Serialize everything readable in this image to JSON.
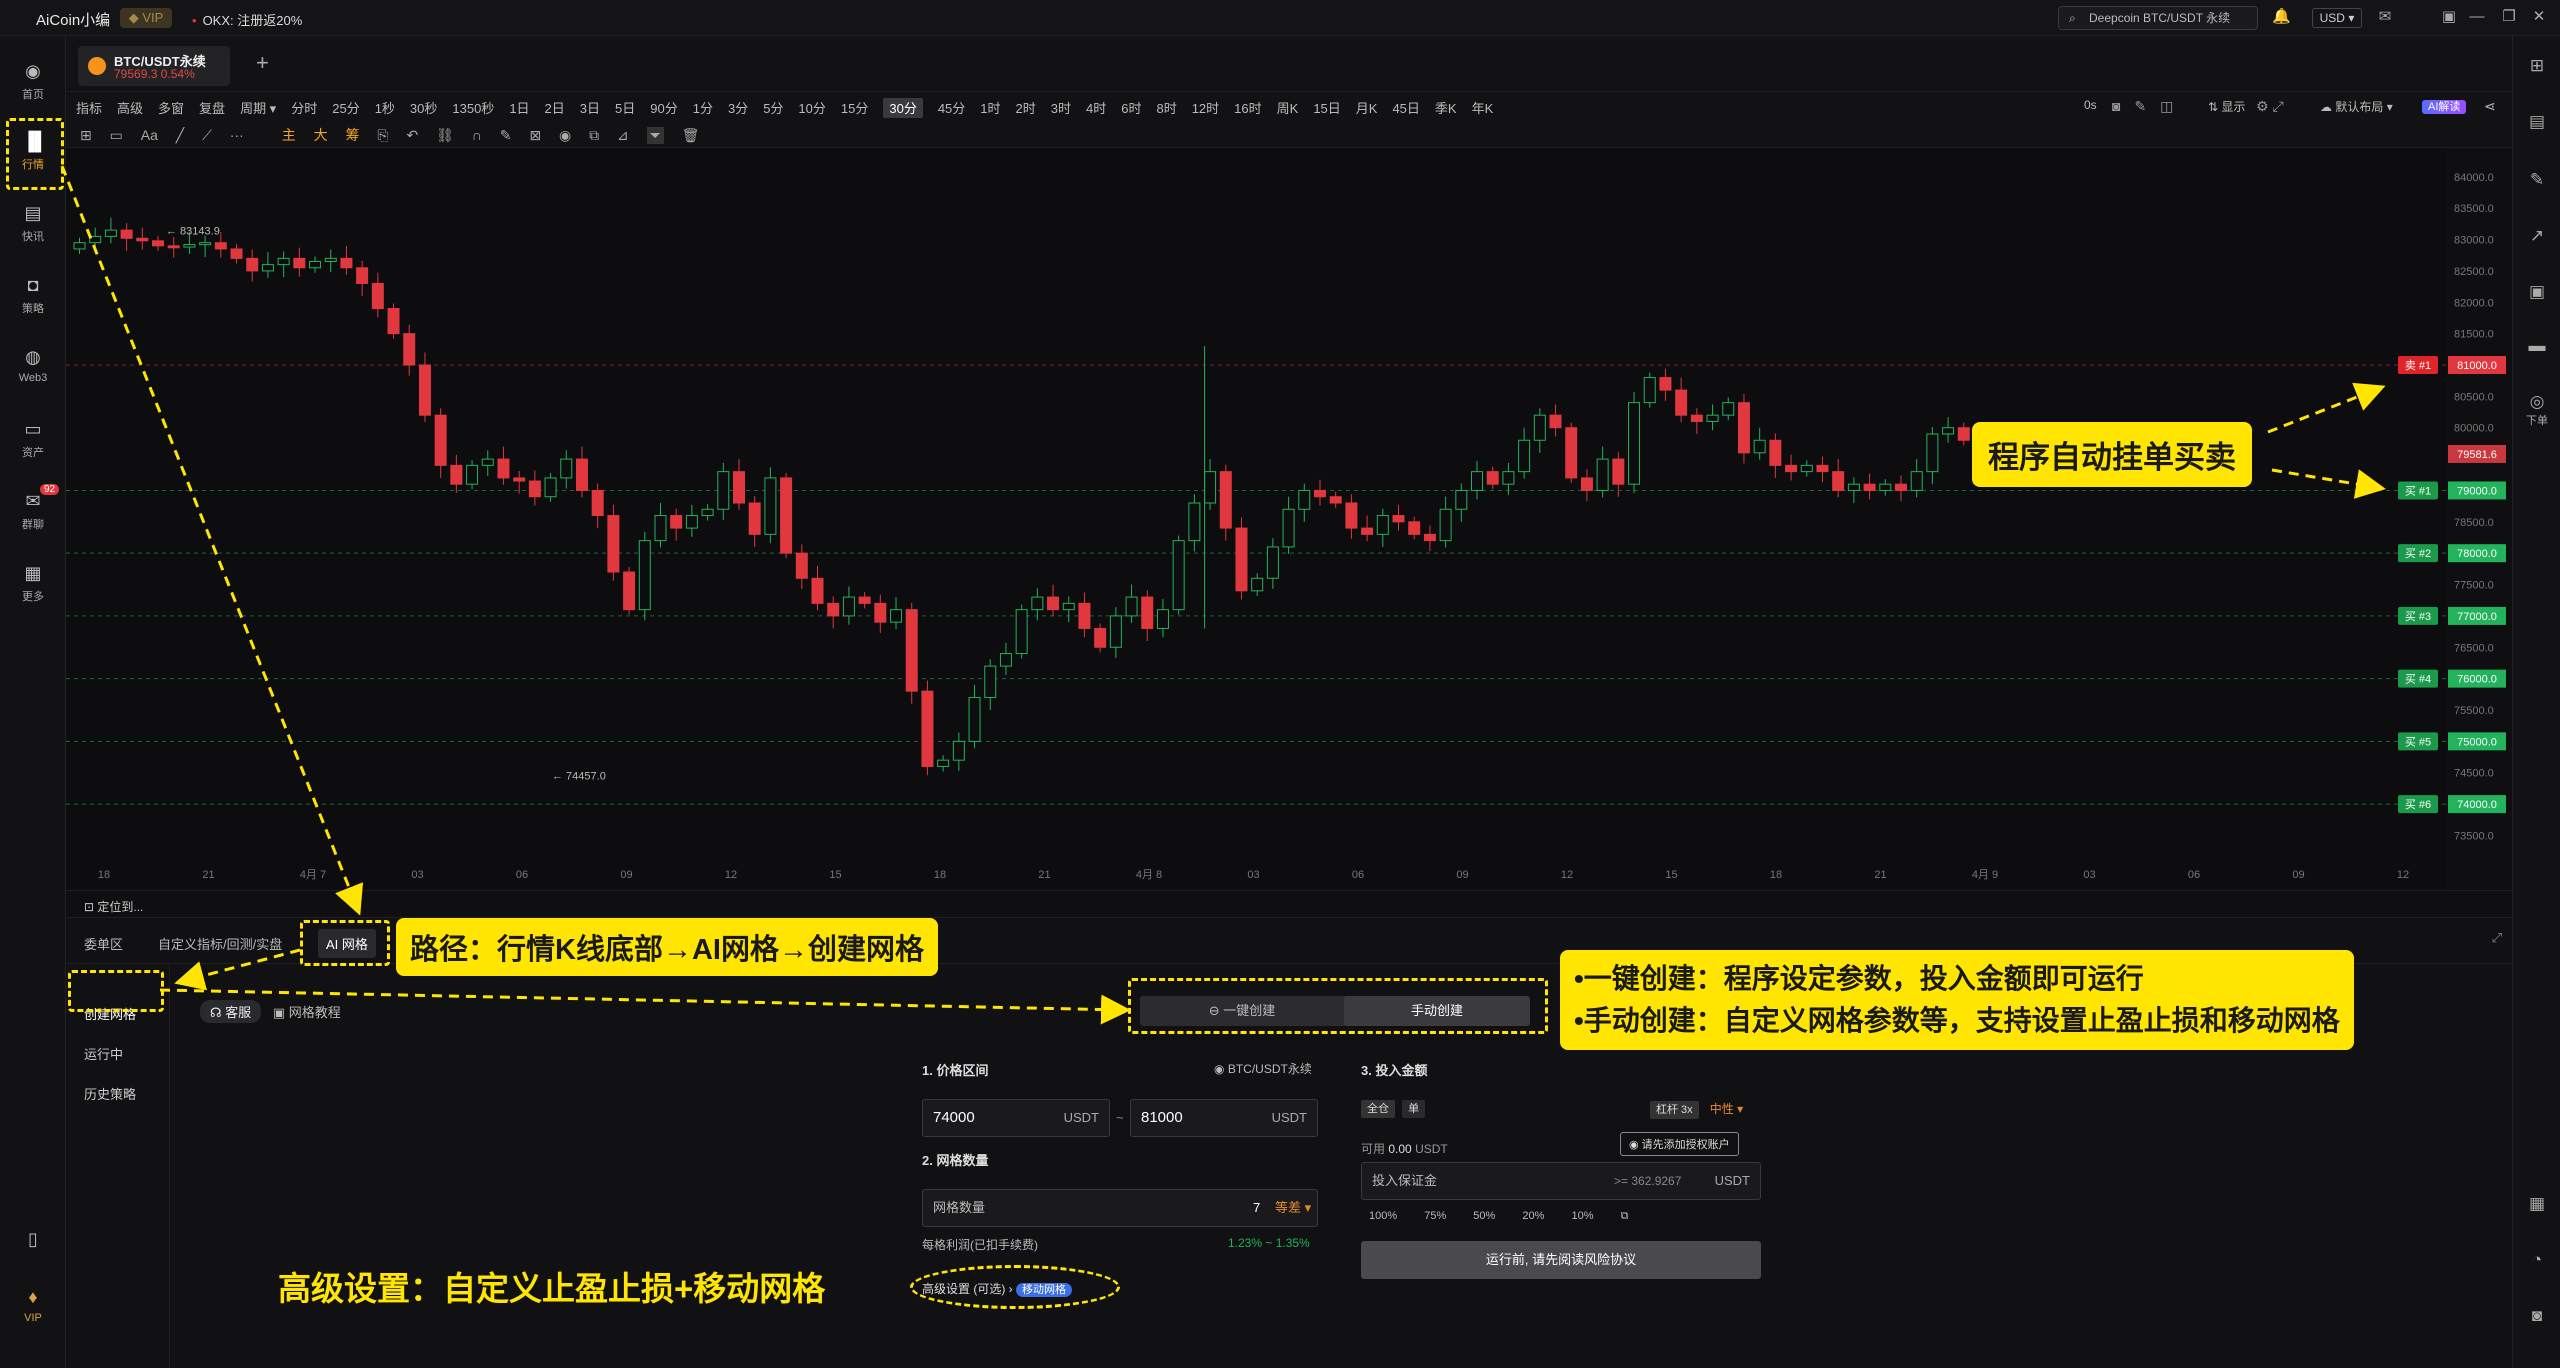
{
  "topbar": {
    "brand": "AiCoin小编",
    "vip": "VIP",
    "promo": "OKX: 注册返20%",
    "search": "Deepcoin BTC/USDT 永续",
    "currency": "USD"
  },
  "leftnav": [
    {
      "label": "首页",
      "icon": "home-icon"
    },
    {
      "label": "行情",
      "icon": "chart-bar-icon"
    },
    {
      "label": "快讯",
      "icon": "news-icon"
    },
    {
      "label": "策略",
      "icon": "robot-icon"
    },
    {
      "label": "Web3",
      "icon": "web3-icon"
    },
    {
      "label": "资产",
      "icon": "wallet-icon"
    },
    {
      "label": "群聊",
      "icon": "chat-icon",
      "badge": "92"
    },
    {
      "label": "更多",
      "icon": "grid-icon"
    },
    {
      "label": "VIP",
      "icon": "diamond-icon"
    }
  ],
  "symbol_tab": {
    "name": "BTC/USDT永续",
    "price": "79569.3",
    "change": "0.54%"
  },
  "toolbar": {
    "items": [
      "指标",
      "高级",
      "多窗",
      "复盘",
      "周期",
      "分时",
      "25分",
      "1秒",
      "30秒",
      "1350秒",
      "1日",
      "2日",
      "3日",
      "5日",
      "90分",
      "1分",
      "3分",
      "5分",
      "10分",
      "15分",
      "30分",
      "45分",
      "1时",
      "2时",
      "3时",
      "4时",
      "6时",
      "8时",
      "12时",
      "16时",
      "周K",
      "15日",
      "月K",
      "45日",
      "季K",
      "年K"
    ],
    "active": "30分",
    "right": [
      "0s",
      "显示",
      "默认布局",
      "AI解读"
    ],
    "drawing": [
      "主",
      "大",
      "筹"
    ]
  },
  "chart_data": {
    "type": "candlestick",
    "symbol": "BTC/USDT永续",
    "yticks": [
      "84000.0",
      "83500.0",
      "83000.0",
      "82500.0",
      "82000.0",
      "81500.0",
      "81000.0",
      "80500.0",
      "80000.0",
      "79500.0",
      "79000.0",
      "78500.0",
      "78000.0",
      "77500.0",
      "77000.0",
      "76500.0",
      "76000.0",
      "75500.0",
      "75000.0",
      "74500.0",
      "74000.0",
      "73500.0"
    ],
    "xticks": [
      "18",
      "21",
      "4月 7",
      "03",
      "06",
      "09",
      "12",
      "15",
      "18",
      "21",
      "4月 8",
      "03",
      "06",
      "09",
      "12",
      "15",
      "18",
      "21",
      "4月 9",
      "03",
      "06",
      "09",
      "12"
    ],
    "high_marker": "83143.9",
    "low_marker": "74457.0",
    "current_price": "79581.6",
    "grid_lines": [
      {
        "label": "卖 #1",
        "price": "81000.0",
        "side": "sell"
      },
      {
        "label": "买 #1",
        "price": "79000.0",
        "side": "buy"
      },
      {
        "label": "买 #2",
        "price": "78000.0",
        "side": "buy"
      },
      {
        "label": "买 #3",
        "price": "77000.0",
        "side": "buy"
      },
      {
        "label": "买 #4",
        "price": "76000.0",
        "side": "buy"
      },
      {
        "label": "买 #5",
        "price": "75000.0",
        "side": "buy"
      },
      {
        "label": "买 #6",
        "price": "74000.0",
        "side": "buy"
      }
    ],
    "closes": [
      82950,
      83050,
      83150,
      83020,
      82980,
      82900,
      82880,
      82920,
      82950,
      82850,
      82700,
      82500,
      82600,
      82700,
      82550,
      82650,
      82700,
      82550,
      82300,
      81900,
      81500,
      81000,
      80200,
      79400,
      79100,
      79400,
      79500,
      79200,
      79150,
      78900,
      79200,
      79500,
      79000,
      78600,
      77700,
      77100,
      78200,
      78600,
      78400,
      78600,
      78700,
      79300,
      78800,
      78300,
      79200,
      78000,
      77600,
      77200,
      77000,
      77300,
      77200,
      76900,
      77100,
      75800,
      74600,
      74700,
      75000,
      75700,
      76200,
      76400,
      77100,
      77300,
      77100,
      77200,
      76800,
      76500,
      77000,
      77300,
      76800,
      77100,
      78200,
      78800,
      79300,
      78400,
      77400,
      77600,
      78100,
      78700,
      79000,
      78900,
      78800,
      78400,
      78300,
      78600,
      78500,
      78300,
      78200,
      78700,
      79000,
      79300,
      79100,
      79300,
      79800,
      80200,
      80000,
      79200,
      79000,
      79500,
      79100,
      80400,
      80800,
      80600,
      80200,
      80100,
      80200,
      80400,
      79600,
      79800,
      79400,
      79300,
      79400,
      79300,
      79000,
      79100,
      79000,
      79100,
      79000,
      79300,
      79900,
      80000,
      79800
    ]
  },
  "locator": "定位到...",
  "bottom": {
    "tabs": [
      "委单区",
      "自定义指标/回测/实盘",
      "AI 网格"
    ],
    "sidelist": [
      "创建网格",
      "运行中",
      "历史策略"
    ],
    "support": "客服",
    "tutorial": "网格教程",
    "mode_one_click": "一键创建",
    "mode_manual": "手动创建",
    "price_range_label": "1. 价格区间",
    "pair": "BTC/USDT永续",
    "lower": "74000",
    "upper": "81000",
    "unit": "USDT",
    "grid_count_label": "2. 网格数量",
    "grid_count_field": "网格数量",
    "grid_count": "7",
    "grid_mode": "等差",
    "profit_label": "每格利润(已扣手续费)",
    "profit_value": "1.23% ~ 1.35%",
    "advanced": "高级设置 (可选)",
    "moving_grid": "移动网格",
    "invest_label": "3. 投入金额",
    "margin_modes": [
      "全仓",
      "单"
    ],
    "leverage": "杠杆 3x",
    "direction": "中性",
    "available_label": "可用",
    "available": "0.00",
    "add_account": "请先添加授权账户",
    "margin_field": "投入保证金",
    "margin_min": ">= 362.9267",
    "percents": [
      "100%",
      "75%",
      "50%",
      "20%",
      "10%"
    ],
    "run": "运行前, 请先阅读风险协议"
  },
  "annotations": {
    "auto_order": "程序自动挂单买卖",
    "path": "路径：行情K线底部→AI网格→创建网格",
    "modes_line1": "•一键创建：程序设定参数，投入金额即可运行",
    "modes_line2": "•手动创建：自定义网格参数等，支持设置止盈止损和移动网格",
    "advanced": "高级设置：自定义止盈止损+移动网格"
  },
  "rightbar": {
    "order_label": "下单"
  },
  "colors": {
    "up": "#22b35c",
    "down": "#e0383e",
    "accent": "#ffe500"
  }
}
